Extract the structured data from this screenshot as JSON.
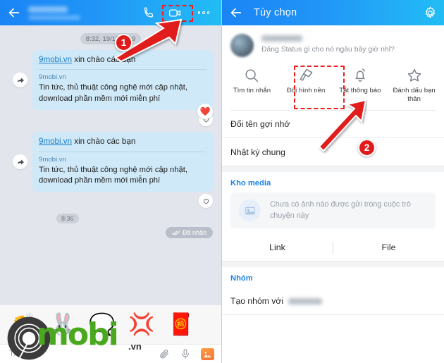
{
  "left_panel": {
    "header": {
      "back_icon": "back-arrow-icon",
      "contact_name_redacted": "",
      "contact_status_redacted": "",
      "call_icon": "phone-call-icon",
      "video_icon": "video-call-icon",
      "more_icon": "more-options-icon"
    },
    "chat": {
      "timestamp_top": "8:32, 19/11/2019",
      "reaction_emoji": "❤️",
      "timestamp_bottom": "8:36",
      "seen_label": "Đã nhận",
      "messages": [
        {
          "title_link": "9mobi.vn",
          "title_rest": " xin chào các bạn",
          "source": "9mobi.vn",
          "body": "Tin tức, thủ thuật công nghệ mới cập nhật, download phần mềm mới miễn phí"
        },
        {
          "title_link": "9mobi.vn",
          "title_rest": " xin chào các bạn",
          "source": "9mobi.vn",
          "body": "Tin tức, thủ thuật công nghệ mới cập nhật, download phần mềm mới miễn phí"
        }
      ]
    },
    "stickers": [
      "👏",
      "🐰",
      "🗨️",
      "💢",
      "🧧"
    ],
    "input": {
      "placeholder": "Tin nhắn",
      "attach_icon": "paperclip-icon",
      "mic_icon": "microphone-icon",
      "gallery_icon": "image-gallery-icon"
    }
  },
  "right_panel": {
    "header": {
      "back_icon": "back-arrow-icon",
      "title": "Tùy chọn",
      "settings_icon": "gear-icon"
    },
    "profile": {
      "name_redacted": "",
      "status": "Đăng Status gì cho nó ngầu bây giờ nhỉ?"
    },
    "actions": [
      {
        "icon": "search-icon",
        "label": "Tìm tin nhắn"
      },
      {
        "icon": "wallpaper-brush-icon",
        "label": "Đổi hình nền"
      },
      {
        "icon": "bell-off-icon",
        "label": "Tắt thông báo"
      },
      {
        "icon": "star-icon",
        "label": "Đánh dấu bạn thân"
      }
    ],
    "menu_items": [
      "Đổi tên gợi nhớ",
      "Nhật ký chung"
    ],
    "media": {
      "section_title": "Kho media",
      "icon": "image-placeholder-icon",
      "empty_text": "Chưa có ảnh nào được gửi trong cuộc trò chuyện này",
      "tabs": [
        "Link",
        "File"
      ]
    },
    "group": {
      "section_title": "Nhóm",
      "create_label": "Tạo nhóm với",
      "member_redacted": ""
    }
  },
  "annotations": {
    "step_one": "1",
    "step_two": "2"
  },
  "watermark": {
    "brand": "mobi",
    "tld": ".vn"
  },
  "colors": {
    "header_start": "#1a84f5",
    "header_end": "#22bdf5",
    "bubble": "#cfe9f8",
    "chat_bg": "#e2e6ec",
    "accent_red": "#ef1d1d",
    "link_blue": "#1a7ec7",
    "section_blue": "#1b84e7"
  }
}
